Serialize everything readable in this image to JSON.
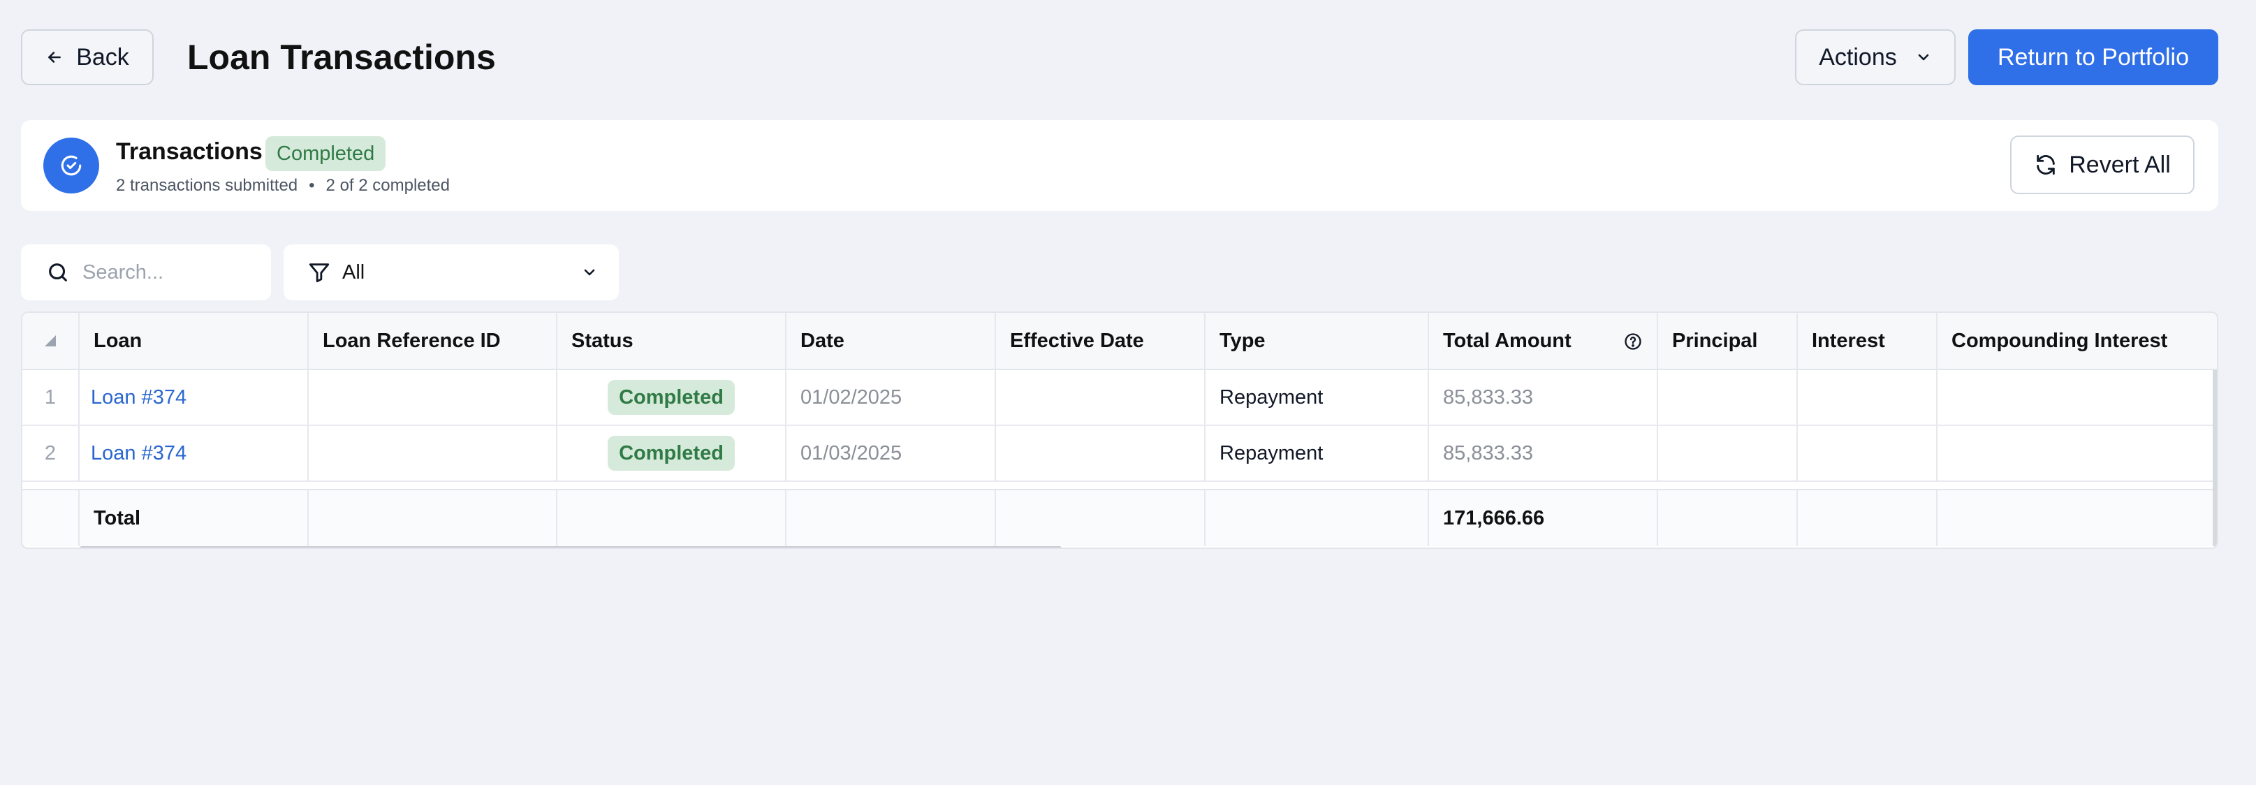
{
  "header": {
    "back_label": "Back",
    "title": "Loan Transactions",
    "actions_label": "Actions",
    "primary_label": "Return to Portfolio"
  },
  "summary": {
    "title": "Transactions",
    "badge": "Completed",
    "submitted": "2 transactions submitted",
    "separator": "•",
    "completed": "2 of 2 completed",
    "revert_label": "Revert All"
  },
  "toolbar": {
    "search_placeholder": "Search...",
    "filter_label": "All"
  },
  "table": {
    "columns": [
      "Loan",
      "Loan Reference ID",
      "Status",
      "Date",
      "Effective Date",
      "Type",
      "Total Amount",
      "Principal",
      "Interest",
      "Compounding Interest"
    ],
    "rows": [
      {
        "num": "1",
        "loan": "Loan #374",
        "ref": "",
        "status": "Completed",
        "date": "01/02/2025",
        "effective": "",
        "type": "Repayment",
        "total": "85,833.33",
        "principal": "",
        "interest": "",
        "compounding": ""
      },
      {
        "num": "2",
        "loan": "Loan #374",
        "ref": "",
        "status": "Completed",
        "date": "01/03/2025",
        "effective": "",
        "type": "Repayment",
        "total": "85,833.33",
        "principal": "",
        "interest": "",
        "compounding": ""
      }
    ],
    "total_label": "Total",
    "total_amount": "171,666.66"
  },
  "colors": {
    "primary": "#2f6fe8",
    "success_bg": "#d6eadb",
    "success_text": "#2f7a45",
    "link": "#2a66cf",
    "page_bg": "#f0f2f7"
  },
  "icons": {
    "back": "arrow-left-icon",
    "actions": "chevron-down-icon",
    "summary": "check-circle-icon",
    "revert": "refresh-icon",
    "search": "search-icon",
    "filter": "filter-icon",
    "help": "help-circle-icon"
  }
}
